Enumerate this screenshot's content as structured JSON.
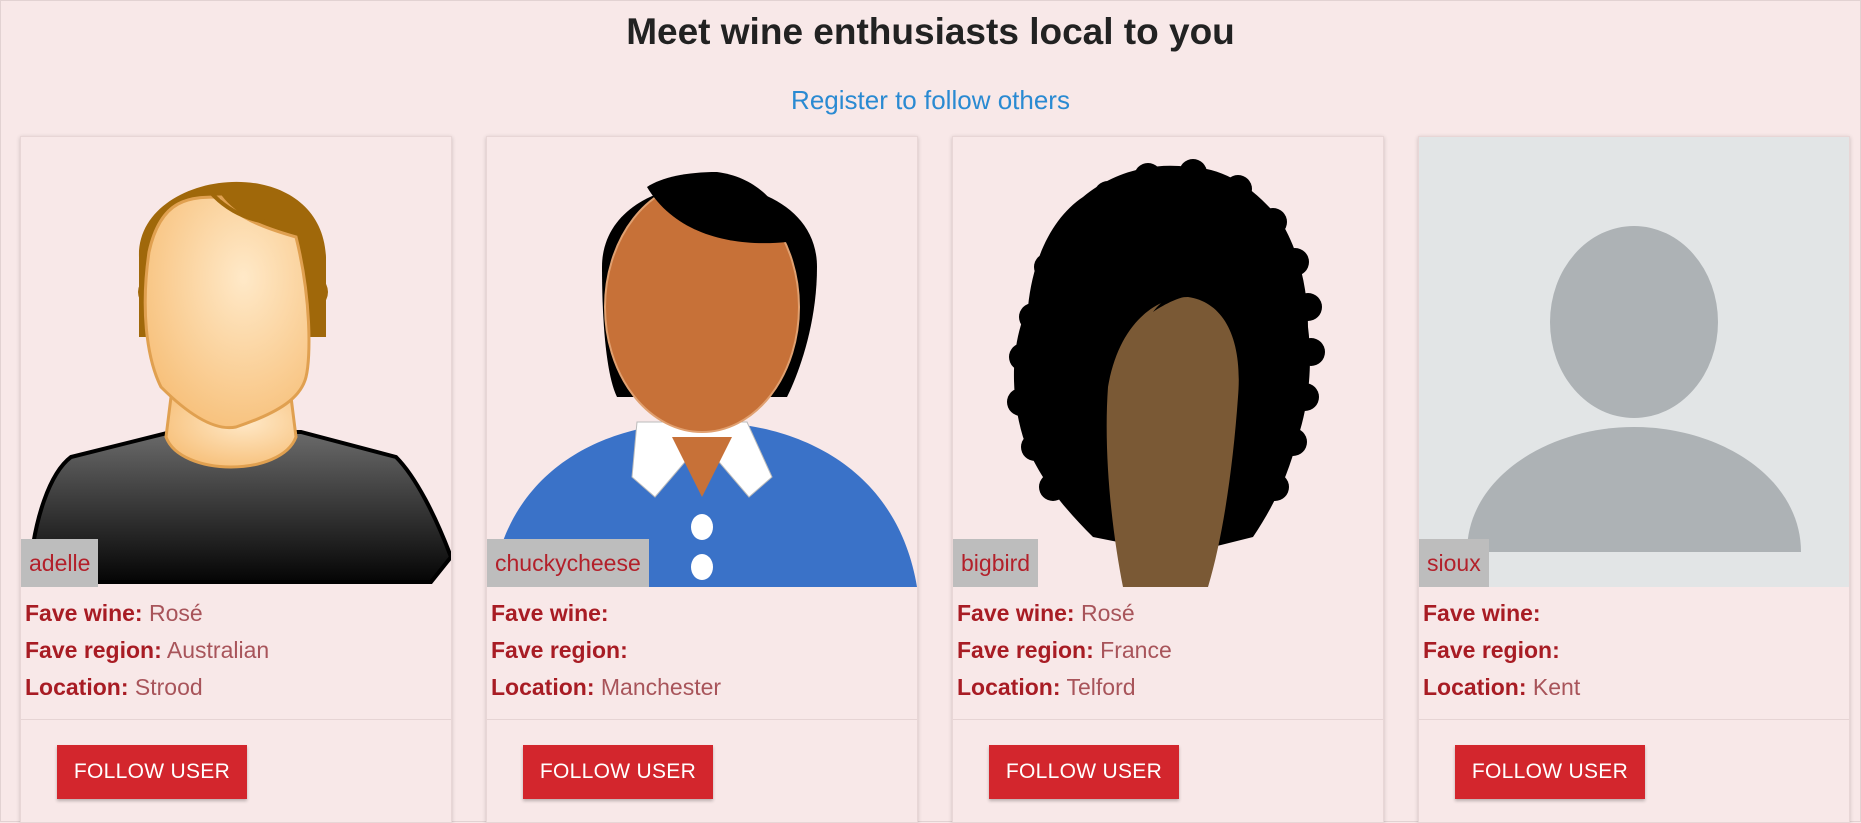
{
  "header": {
    "title": "Meet wine enthusiasts local to you",
    "register_link": "Register to follow others"
  },
  "labels": {
    "fave_wine": "Fave wine:",
    "fave_region": "Fave region:",
    "location": "Location:",
    "follow_button": "FOLLOW USER"
  },
  "users": [
    {
      "username": "adelle",
      "fave_wine": "Rosé",
      "fave_region": "Australian",
      "location": "Strood",
      "avatar_icon": "man-avatar-icon"
    },
    {
      "username": "chuckycheese",
      "fave_wine": "",
      "fave_region": "",
      "location": "Manchester",
      "avatar_icon": "woman-avatar-icon"
    },
    {
      "username": "bigbird",
      "fave_wine": "Rosé",
      "fave_region": "France",
      "location": "Telford",
      "avatar_icon": "curly-hair-avatar-icon"
    },
    {
      "username": "sioux",
      "fave_wine": "",
      "fave_region": "",
      "location": "Kent",
      "avatar_icon": "default-user-icon"
    }
  ],
  "colors": {
    "background": "#f8e8e8",
    "accent": "#d3262d",
    "link": "#2a8ad2",
    "label": "#a81c24"
  }
}
